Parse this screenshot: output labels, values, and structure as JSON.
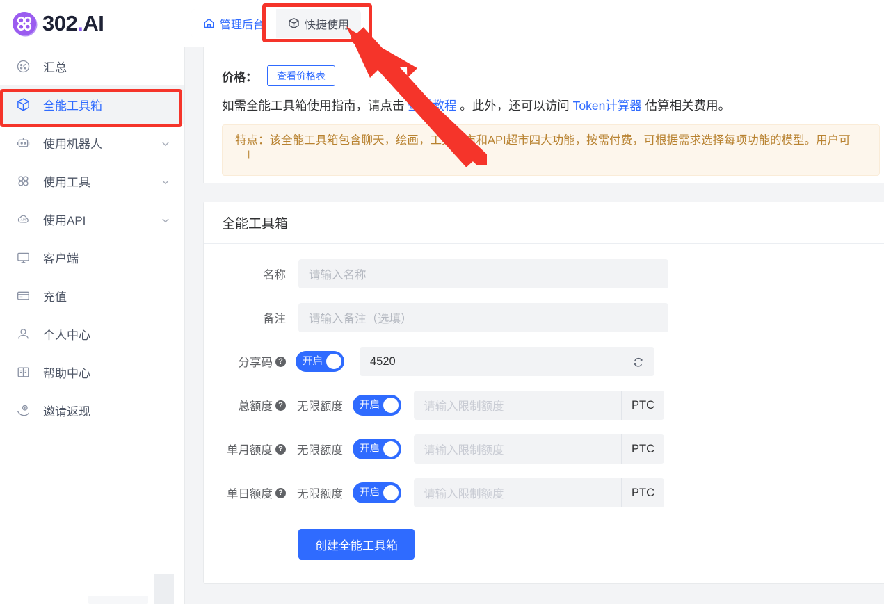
{
  "brand": {
    "name_prefix": "302",
    "dot": ".",
    "name_suffix": "AI",
    "logo_color": "#8b5cf6"
  },
  "header": {
    "tabs": [
      {
        "label": "管理后台",
        "icon": "home-icon",
        "active": false
      },
      {
        "label": "快捷使用",
        "icon": "cube-icon",
        "active": true
      }
    ]
  },
  "sidebar": {
    "items": [
      {
        "label": "汇总",
        "icon": "dashboard-icon",
        "active": false,
        "expandable": false
      },
      {
        "label": "全能工具箱",
        "icon": "cube-icon",
        "active": true,
        "expandable": false
      },
      {
        "label": "使用机器人",
        "icon": "robot-icon",
        "active": false,
        "expandable": true
      },
      {
        "label": "使用工具",
        "icon": "grid-icon",
        "active": false,
        "expandable": true
      },
      {
        "label": "使用API",
        "icon": "api-cloud-icon",
        "active": false,
        "expandable": true
      },
      {
        "label": "客户端",
        "icon": "monitor-icon",
        "active": false,
        "expandable": false
      },
      {
        "label": "充值",
        "icon": "card-icon",
        "active": false,
        "expandable": false
      },
      {
        "label": "个人中心",
        "icon": "user-icon",
        "active": false,
        "expandable": false
      },
      {
        "label": "帮助中心",
        "icon": "book-icon",
        "active": false,
        "expandable": false
      },
      {
        "label": "邀请返现",
        "icon": "hand-cash-icon",
        "active": false,
        "expandable": false
      }
    ]
  },
  "info_card": {
    "price_label": "价格：",
    "price_button": "查看价格表",
    "guide": {
      "part1": "如需全能工具箱使用指南，请点击 ",
      "link1": "查看教程",
      "part2": " 。此外，还可以访问 ",
      "link2": "Token计算器",
      "part3": " 估算相关费用。"
    },
    "notice": "特点：该全能工具箱包含聊天，绘画，工具超市和API超市四大功能，按需付费，可根据需求选择每项功能的模型。用户可",
    "notice_cursor": "|"
  },
  "form": {
    "title": "全能工具箱",
    "rows": [
      {
        "label": "名称",
        "has_help": false,
        "placeholder": "请输入名称",
        "value": ""
      },
      {
        "label": "备注",
        "has_help": false,
        "placeholder": "请输入备注（选填）",
        "value": ""
      }
    ],
    "share_code": {
      "label": "分享码",
      "has_help": true,
      "toggle_label": "开启",
      "toggle_on": true,
      "value": "4520",
      "refresh_icon": "refresh-icon"
    },
    "quotas": [
      {
        "label": "总额度",
        "has_help": true,
        "inline_label": "无限额度",
        "toggle_label": "开启",
        "toggle_on": true,
        "placeholder": "请输入限制额度",
        "unit": "PTC"
      },
      {
        "label": "单月额度",
        "has_help": true,
        "inline_label": "无限额度",
        "toggle_label": "开启",
        "toggle_on": true,
        "placeholder": "请输入限制额度",
        "unit": "PTC"
      },
      {
        "label": "单日额度",
        "has_help": true,
        "inline_label": "无限额度",
        "toggle_label": "开启",
        "toggle_on": true,
        "placeholder": "请输入限制额度",
        "unit": "PTC"
      }
    ],
    "submit_label": "创建全能工具箱",
    "help_glyph": "?"
  },
  "colors": {
    "primary": "#2f6bff",
    "annotation": "#f5342a",
    "notice_bg": "#fdf6ec",
    "notice_text": "#b88230"
  }
}
